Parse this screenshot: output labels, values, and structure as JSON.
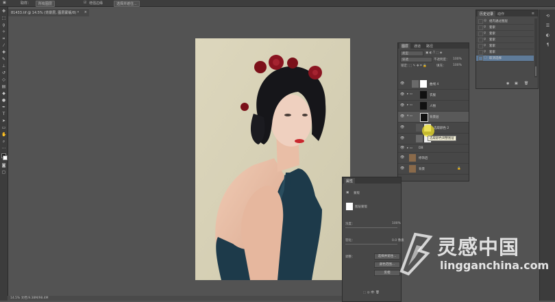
{
  "options_bar": {
    "sample_label": "取样：",
    "layer_select": "所有图层",
    "enhance_label": "增强边缘",
    "select_subject_button": "选择并遮住..."
  },
  "document": {
    "tab_title": "81433.tif @ 14.5% (背景层, 图层蒙版/8) *",
    "close": "×",
    "status": "14.5%    文档:9.38M/98.4M"
  },
  "history_panel": {
    "tabs": [
      "历史记录",
      "动作"
    ],
    "items": [
      {
        "label": "组内通过图层"
      },
      {
        "label": "套索"
      },
      {
        "label": "套索"
      },
      {
        "label": "套索"
      },
      {
        "label": "套索"
      },
      {
        "label": "套索"
      },
      {
        "label": "取消选择"
      }
    ]
  },
  "layers_panel": {
    "tabs": [
      "图层",
      "通道",
      "路径"
    ],
    "filter_kind": "类型",
    "blend_mode": "穿透",
    "opacity_label": "不透明度：",
    "opacity_value": "100%",
    "fill_label": "填充：",
    "fill_value": "100%",
    "lock_label": "锁定：",
    "layers": [
      {
        "name": "曲线 4"
      },
      {
        "name": "衣服"
      },
      {
        "name": "人物"
      },
      {
        "name": "背景层"
      },
      {
        "name": "选取颜色 2"
      },
      {
        "name": "曲线 1"
      },
      {
        "name": "DB"
      },
      {
        "name": "修饰后"
      },
      {
        "name": "背景"
      }
    ],
    "tooltip": "选取颜色调整图层"
  },
  "properties_panel": {
    "title": "属性",
    "section": "蒙版",
    "mask_label": "图层蒙版",
    "density_label": "浓度：",
    "density_value": "100%",
    "feather_label": "羽化：",
    "feather_value": "0.0 像素",
    "refine_label": "调整：",
    "select_and_mask_button": "选择并遮住...",
    "color_range_button": "颜色范围...",
    "invert_button": "反相"
  },
  "watermark": {
    "chinese": "灵感中国",
    "url": "lingganchina.com"
  }
}
